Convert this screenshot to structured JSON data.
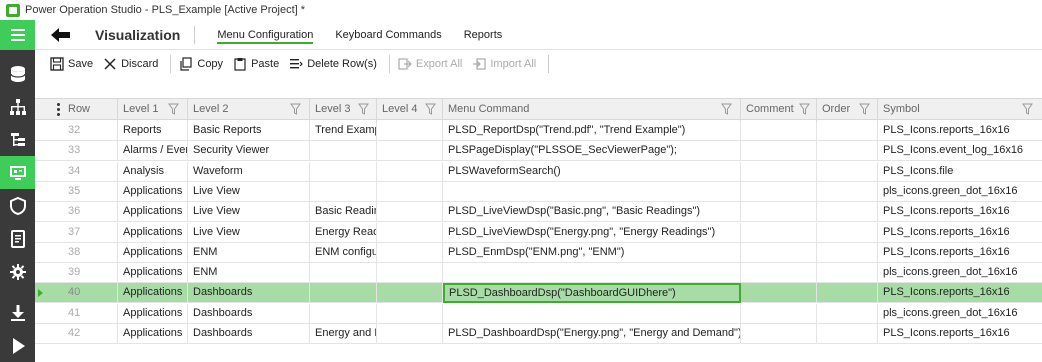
{
  "window": {
    "title": "Power Operation Studio - PLS_Example [Active Project] *"
  },
  "sidebar": {
    "items": [
      {
        "icon": "hamburger-menu-icon"
      },
      {
        "icon": "database-icon"
      },
      {
        "icon": "hierarchy-icon"
      },
      {
        "icon": "tree-icon"
      },
      {
        "icon": "monitor-icon"
      },
      {
        "icon": "shield-icon"
      },
      {
        "icon": "document-icon"
      },
      {
        "icon": "gear-icon"
      },
      {
        "icon": "download-icon"
      },
      {
        "icon": "play-icon"
      }
    ],
    "active_index": 4,
    "accent_color": "#3dcd58"
  },
  "header": {
    "back_icon": "back-arrow-icon",
    "title": "Visualization",
    "tabs": [
      {
        "label": "Menu Configuration",
        "active": true
      },
      {
        "label": "Keyboard Commands",
        "active": false
      },
      {
        "label": "Reports",
        "active": false
      }
    ]
  },
  "toolbar": {
    "save_label": "Save",
    "discard_label": "Discard",
    "copy_label": "Copy",
    "paste_label": "Paste",
    "delete_label": "Delete Row(s)",
    "export_label": "Export All",
    "import_label": "Import All"
  },
  "grid": {
    "columns": {
      "row": "Row",
      "level1": "Level 1",
      "level2": "Level 2",
      "level3": "Level 3",
      "level4": "Level 4",
      "menu_command": "Menu Command",
      "comment": "Comment",
      "order": "Order",
      "symbol": "Symbol"
    },
    "selected_row_index": 8,
    "rows": [
      {
        "row": "32",
        "level1": "Reports",
        "level2": "Basic Reports",
        "level3": "Trend Example",
        "level4": "",
        "menu_command": "PLSD_ReportDsp(\"Trend.pdf\", \"Trend Example\")",
        "comment": "",
        "order": "",
        "symbol": "PLS_Icons.reports_16x16"
      },
      {
        "row": "33",
        "level1": "Alarms / Events",
        "level2": "Security Viewer",
        "level3": "",
        "level4": "",
        "menu_command": "PLSPageDisplay(\"PLSSOE_SecViewerPage\");",
        "comment": "",
        "order": "",
        "symbol": "PLS_Icons.event_log_16x16"
      },
      {
        "row": "34",
        "level1": "Analysis",
        "level2": "Waveform",
        "level3": "",
        "level4": "",
        "menu_command": "PLSWaveformSearch()",
        "comment": "",
        "order": "",
        "symbol": "PLS_Icons.file"
      },
      {
        "row": "35",
        "level1": "Applications",
        "level2": "Live View",
        "level3": "",
        "level4": "",
        "menu_command": "",
        "comment": "",
        "order": "",
        "symbol": "pls_icons.green_dot_16x16"
      },
      {
        "row": "36",
        "level1": "Applications",
        "level2": "Live View",
        "level3": "Basic Readings",
        "level4": "",
        "menu_command": "PLSD_LiveViewDsp(\"Basic.png\", \"Basic Readings\")",
        "comment": "",
        "order": "",
        "symbol": "PLS_Icons.reports_16x16"
      },
      {
        "row": "37",
        "level1": "Applications",
        "level2": "Live View",
        "level3": "Energy Readings",
        "level4": "",
        "menu_command": "PLSD_LiveViewDsp(\"Energy.png\", \"Energy Readings\")",
        "comment": "",
        "order": "",
        "symbol": "PLS_Icons.reports_16x16"
      },
      {
        "row": "38",
        "level1": "Applications",
        "level2": "ENM",
        "level3": "ENM configuration",
        "level4": "",
        "menu_command": "PLSD_EnmDsp(\"ENM.png\", \"ENM\")",
        "comment": "",
        "order": "",
        "symbol": "PLS_Icons.reports_16x16"
      },
      {
        "row": "39",
        "level1": "Applications",
        "level2": "ENM",
        "level3": "",
        "level4": "",
        "menu_command": "",
        "comment": "",
        "order": "",
        "symbol": "pls_icons.green_dot_16x16"
      },
      {
        "row": "40",
        "level1": "Applications",
        "level2": "Dashboards",
        "level3": "",
        "level4": "",
        "menu_command": "PLSD_DashboardDsp(\"DashboardGUIDhere\")",
        "comment": "",
        "order": "",
        "symbol": "PLS_Icons.reports_16x16"
      },
      {
        "row": "41",
        "level1": "Applications",
        "level2": "Dashboards",
        "level3": "",
        "level4": "",
        "menu_command": "",
        "comment": "",
        "order": "",
        "symbol": "pls_icons.green_dot_16x16"
      },
      {
        "row": "42",
        "level1": "Applications",
        "level2": "Dashboards",
        "level3": "Energy and Demand",
        "level4": "",
        "menu_command": "PLSD_DashboardDsp(\"Energy.png\", \"Energy and Demand\")",
        "comment": "",
        "order": "",
        "symbol": "PLS_Icons.reports_16x16"
      }
    ]
  }
}
